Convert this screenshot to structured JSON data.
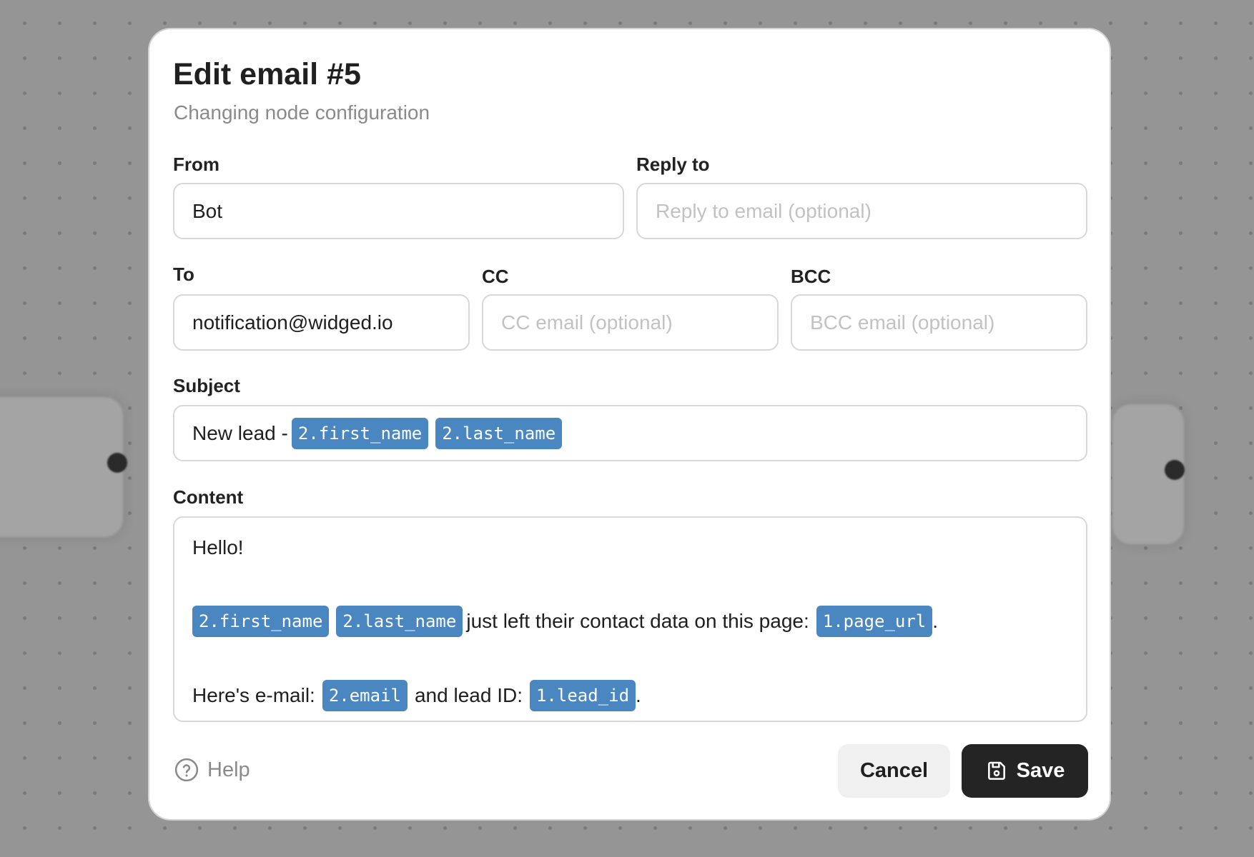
{
  "modal": {
    "title": "Edit email #5",
    "subtitle": "Changing node configuration"
  },
  "fields": {
    "from": {
      "label": "From",
      "value": "Bot",
      "placeholder": ""
    },
    "reply_to": {
      "label": "Reply to",
      "value": "",
      "placeholder": "Reply to email (optional)"
    },
    "to": {
      "label": "To",
      "value": "notification@widged.io",
      "placeholder": ""
    },
    "cc": {
      "label": "CC",
      "value": "",
      "placeholder": "CC email (optional)"
    },
    "bcc": {
      "label": "BCC",
      "value": "",
      "placeholder": "BCC email (optional)"
    },
    "subject": {
      "label": "Subject",
      "text": "New lead - ",
      "tags": [
        "2.first_name",
        "2.last_name"
      ]
    },
    "content": {
      "label": "Content",
      "greeting": "Hello!",
      "line2": {
        "tag1": "2.first_name",
        "tag2": "2.last_name",
        "text": "just left their contact data on this page:",
        "tag3": "1.page_url",
        "end": "."
      },
      "line3": {
        "text1": "Here's e-mail:",
        "tag1": "2.email",
        "text2": "and lead ID:",
        "tag2": "1.lead_id",
        "end": "."
      }
    }
  },
  "footer": {
    "help_label": "Help",
    "help_icon": "question-circle-icon",
    "cancel_label": "Cancel",
    "save_label": "Save",
    "save_icon": "floppy-disk-icon"
  },
  "colors": {
    "tag_bg": "#4a86c0",
    "save_bg": "#242424",
    "cancel_bg": "#f0f0f0",
    "backdrop": "#959595"
  }
}
